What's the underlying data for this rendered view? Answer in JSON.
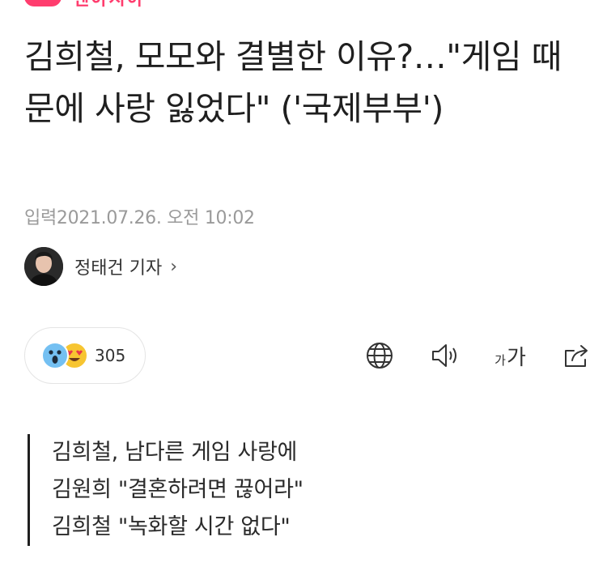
{
  "brand": {
    "name": "텐아시아"
  },
  "article": {
    "headline": "김희철, 모모와 결별한 이유?…\"게임 때문에 사랑 잃었다\" ('국제부부')",
    "date_label": "입력",
    "date_value": "2021.07.26. 오전 10:02",
    "author": "정태건 기자",
    "author_chevron": "›"
  },
  "reactions": {
    "count": "305"
  },
  "toolbar": {
    "font_small": "가",
    "font_large": "가"
  },
  "summary": [
    "김희철, 남다른 게임 사랑에",
    "김원희 \"결혼하려면 끊어라\"",
    "김희철 \"녹화할 시간 없다\""
  ],
  "icons": {
    "language": "globe-icon",
    "listen": "speaker-icon",
    "font_size": "font-size-icon",
    "share": "share-icon"
  },
  "colors": {
    "brand": "#ff3d6e",
    "text": "#1f1f1f",
    "muted": "#9a9a9a"
  }
}
